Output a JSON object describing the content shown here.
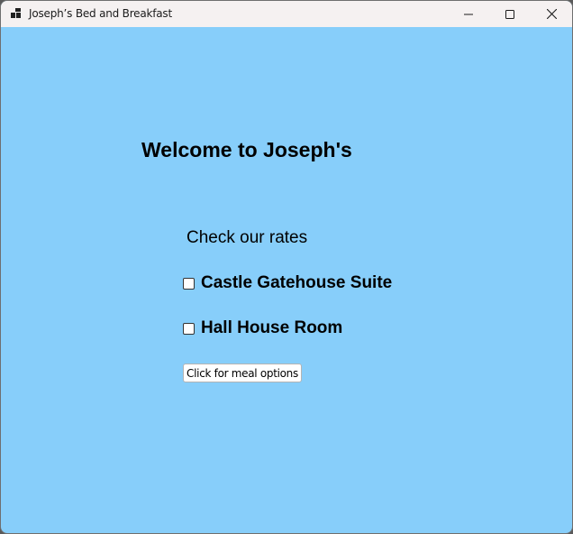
{
  "window": {
    "title": "Joseph’s Bed and Breakfast",
    "icon": "app-window-icon",
    "controls": [
      "minimize-icon",
      "maximize-icon",
      "close-icon"
    ]
  },
  "main": {
    "welcome": "Welcome to Joseph's",
    "rates_heading": "Check our rates",
    "options": [
      {
        "label": "Castle Gatehouse Suite",
        "checked": false
      },
      {
        "label": "Hall House Room",
        "checked": false
      }
    ],
    "meal_button_label": "Click for meal options"
  },
  "colors": {
    "background": "#87cefa",
    "titlebar": "#f5f1f1"
  }
}
